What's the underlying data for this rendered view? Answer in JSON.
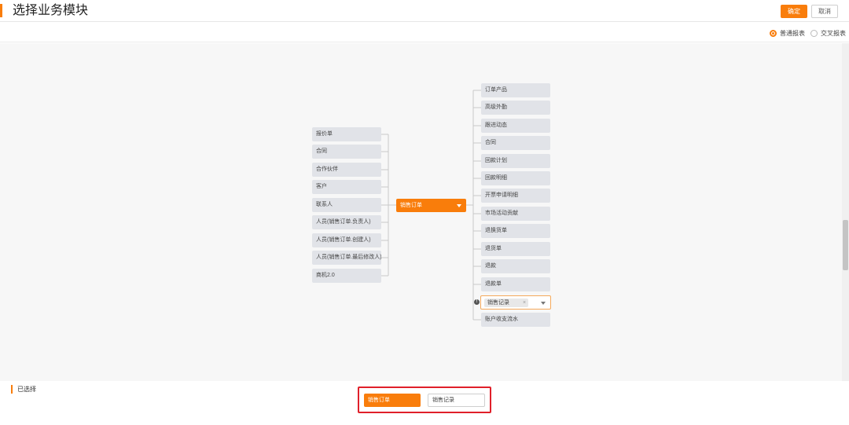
{
  "header": {
    "title": "选择业务模块",
    "ok_label": "确定",
    "cancel_label": "取消"
  },
  "report_types": {
    "normal": "普通报表",
    "cross": "交叉报表",
    "selected": "normal"
  },
  "tree": {
    "center": "销售订单",
    "left_nodes": [
      "报价单",
      "合同",
      "合作伙伴",
      "客户",
      "联系人",
      "人员(销售订单.负责人)",
      "人员(销售订单.创建人)",
      "人员(销售订单.最后修改人)",
      "商机2.0"
    ],
    "right_nodes": [
      "订单产品",
      "高级外勤",
      "跟进动态",
      "合同",
      "回款计划",
      "回款明细",
      "开票申请明细",
      "市场活动贡献",
      "退换货单",
      "退货单",
      "退款",
      "退款单"
    ],
    "selected_node": {
      "tag": "销售记录",
      "remove": "×"
    },
    "after_selected": [
      "账户收支流水"
    ]
  },
  "selected_section": {
    "title": "已选择",
    "items": [
      "销售订单",
      "销售记录"
    ]
  },
  "colors": {
    "accent": "#f97d0b",
    "highlight_border": "#e0202a"
  }
}
